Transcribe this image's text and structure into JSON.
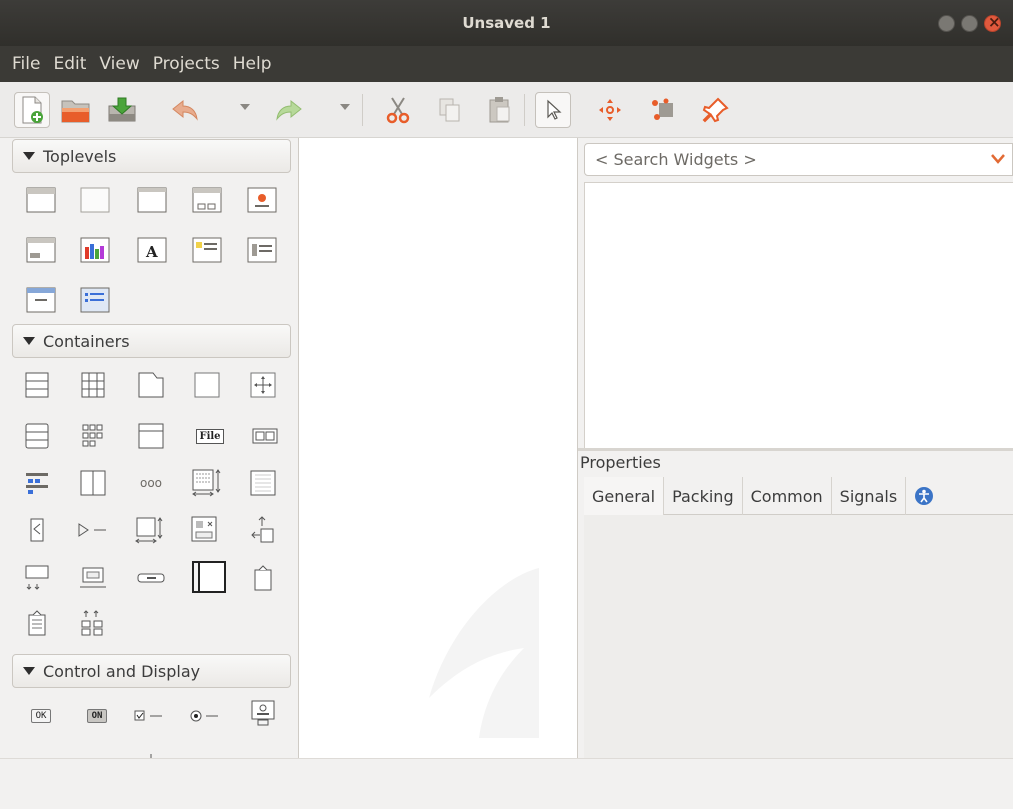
{
  "window": {
    "title": "Unsaved 1"
  },
  "menu": [
    "File",
    "Edit",
    "View",
    "Projects",
    "Help"
  ],
  "toolbar": {
    "items": [
      "new-icon",
      "open-icon",
      "save-icon",
      "undo-icon",
      "redo-icon",
      "cut-icon",
      "copy-icon",
      "paste-icon",
      "pointer-icon",
      "drag-resize-icon",
      "margins-icon",
      "pin-icon"
    ]
  },
  "palette": {
    "toplevels": {
      "label": "Toplevels"
    },
    "containers": {
      "label": "Containers",
      "icon_labels": {
        "file": "File",
        "dots": "ooo"
      }
    },
    "control_display": {
      "label": "Control and Display",
      "icon_labels": {
        "ok": "OK",
        "on": "ON"
      }
    }
  },
  "search": {
    "placeholder": "< Search Widgets >"
  },
  "properties": {
    "title": "Properties",
    "tabs": [
      "General",
      "Packing",
      "Common",
      "Signals"
    ]
  },
  "colors": {
    "accent": "#e0593d",
    "titlebar": "#3b3a36"
  }
}
